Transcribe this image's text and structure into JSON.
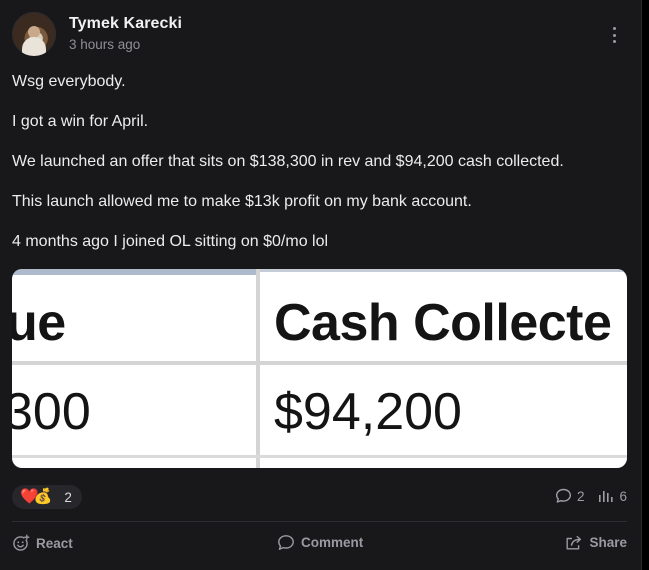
{
  "post": {
    "author": "Tymek Karecki",
    "timestamp": "3 hours ago",
    "paragraphs": [
      "Wsg everybody.",
      "I got a win for April.",
      "We launched an offer that sits on $138,300 in rev and $94,200 cash collected.",
      "This launch allowed me to make $13k profit on my bank account.",
      "4 months ago I joined OL sitting on $0/mo lol"
    ],
    "image": {
      "header_left": "ue",
      "header_right": "Cash Collecte",
      "value_left": "300",
      "value_right": "$94,200"
    }
  },
  "reactions": {
    "emojis": [
      "❤️",
      "💰"
    ],
    "count": "2"
  },
  "stats": {
    "comments": "2",
    "views": "6"
  },
  "actions": {
    "react": "React",
    "comment": "Comment",
    "share": "Share"
  },
  "icons": {
    "more": "more-vertical-icon",
    "comment": "comment-bubble-icon",
    "views": "bar-chart-icon",
    "react": "emoji-add-icon",
    "share": "share-icon"
  }
}
